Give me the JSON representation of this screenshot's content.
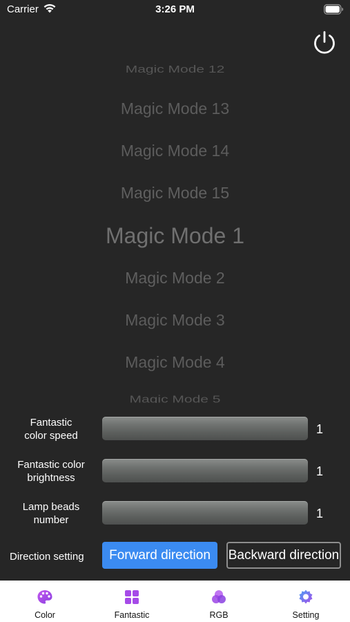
{
  "status_bar": {
    "carrier": "Carrier",
    "time": "3:26 PM"
  },
  "picker": {
    "items": [
      "Magic Mode 12",
      "Magic Mode 13",
      "Magic Mode 14",
      "Magic Mode 15",
      "Magic Mode 1",
      "Magic Mode 2",
      "Magic Mode 3",
      "Magic Mode 4",
      "Magic Mode 5"
    ],
    "selected": "Magic Mode 1"
  },
  "sliders": [
    {
      "label": "Fantastic color speed",
      "value": "1"
    },
    {
      "label": "Fantastic color brightness",
      "value": "1"
    },
    {
      "label": "Lamp beads number",
      "value": "1"
    }
  ],
  "direction": {
    "label": "Direction setting",
    "forward": "Forward direction",
    "backward": "Backward direction",
    "selected": "Forward direction"
  },
  "tab_bar": {
    "tabs": [
      {
        "label": "Color",
        "icon": "palette-icon"
      },
      {
        "label": "Fantastic",
        "icon": "grid-icon"
      },
      {
        "label": "RGB",
        "icon": "rgb-circles-icon"
      },
      {
        "label": "Setting",
        "icon": "gear-icon"
      }
    ]
  },
  "colors": {
    "background": "#262626",
    "accent": "#3b8bf1",
    "tab_icon_purple": "#a64be8"
  }
}
